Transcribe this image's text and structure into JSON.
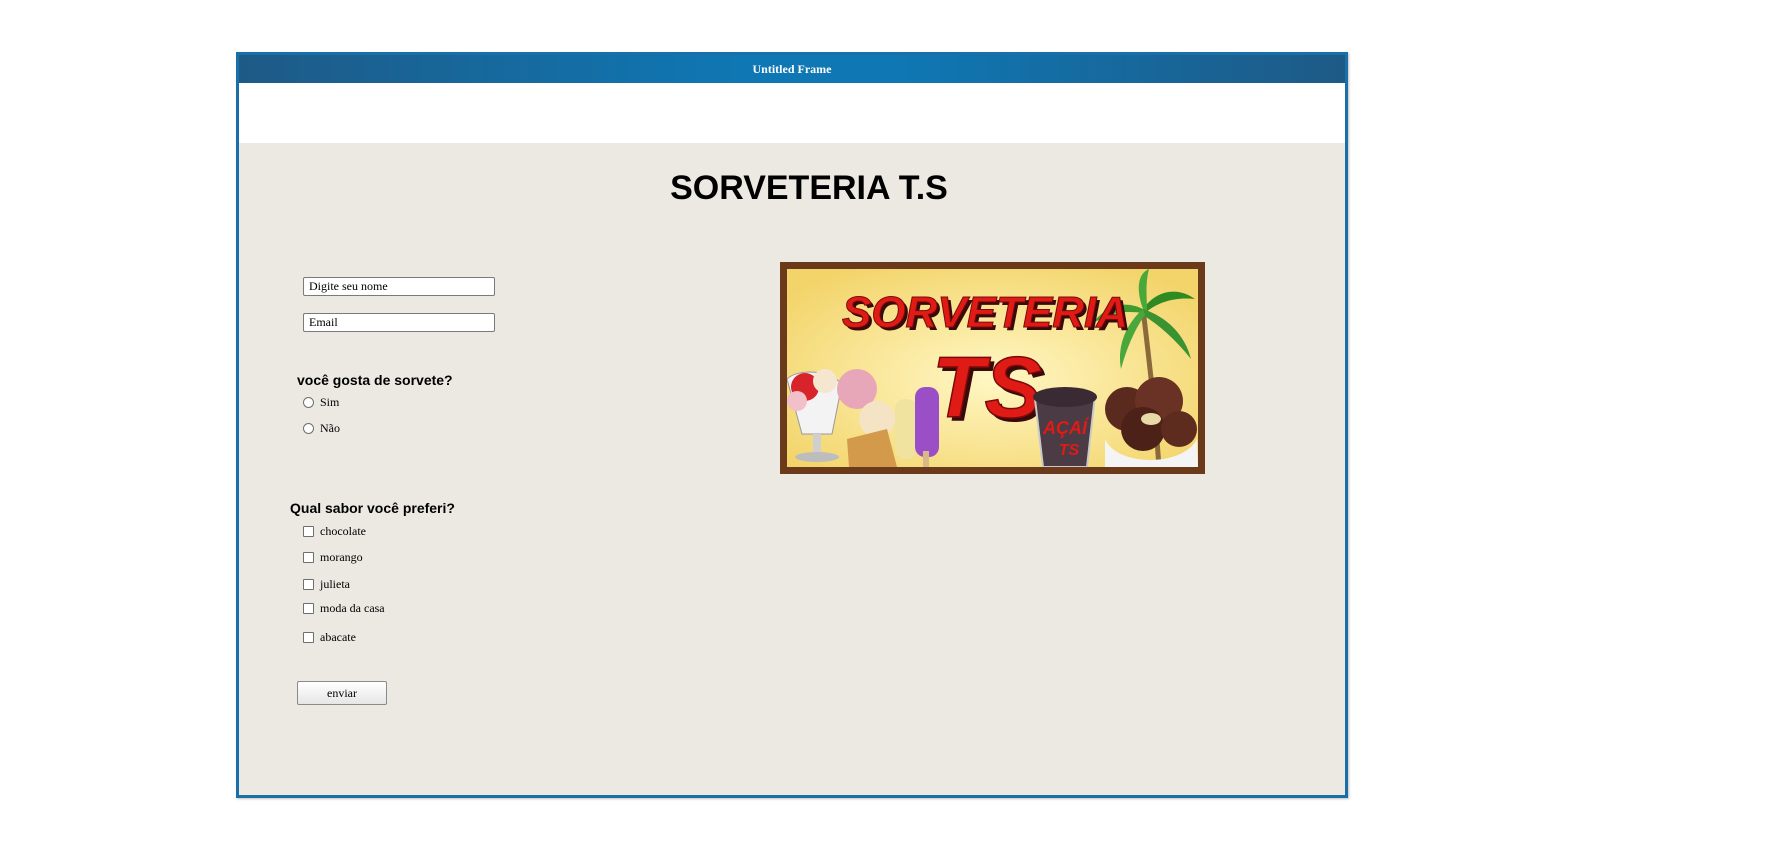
{
  "window": {
    "title": "Untitled Frame"
  },
  "page": {
    "heading": "SORVETERIA T.S"
  },
  "form": {
    "name_placeholder": "Digite seu nome",
    "email_placeholder": "Email",
    "question1": "você gosta de sorvete?",
    "question1_options": [
      "Sim",
      "Não"
    ],
    "question2": "Qual sabor você preferi?",
    "question2_options": [
      "chocolate",
      "morango",
      "julieta",
      "moda da casa",
      "abacate"
    ],
    "submit_label": "enviar"
  },
  "logo": {
    "line1": "SORVETERIA",
    "line2": "TS",
    "badge": "AÇAÍ",
    "badge2": "TS"
  },
  "colors": {
    "titlebar": "#0f77b3",
    "panel": "#ece9e3",
    "logo_red": "#e01b16",
    "logo_frame": "#6b3a1a"
  }
}
